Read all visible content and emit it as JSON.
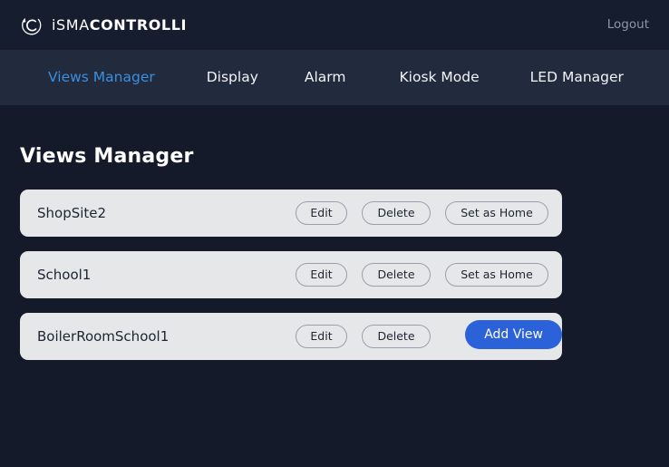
{
  "header": {
    "brand_light": "iSMA",
    "brand_bold": "CONTROLLI",
    "logo_icon": "isma-circle-logo-icon",
    "logout_label": "Logout"
  },
  "nav": {
    "items": [
      {
        "label": "Views Manager",
        "active": true
      },
      {
        "label": "Display",
        "active": false
      },
      {
        "label": "Alarm",
        "active": false
      },
      {
        "label": "Kiosk Mode",
        "active": false
      },
      {
        "label": "LED Manager",
        "active": false
      }
    ]
  },
  "main": {
    "title": "Views Manager",
    "views": [
      {
        "name": "ShopSite2",
        "edit_label": "Edit",
        "delete_label": "Delete",
        "set_home_label": "Set as Home",
        "has_set_home": true
      },
      {
        "name": "School1",
        "edit_label": "Edit",
        "delete_label": "Delete",
        "set_home_label": "Set as Home",
        "has_set_home": true
      },
      {
        "name": "BoilerRoomSchool1",
        "edit_label": "Edit",
        "delete_label": "Delete",
        "set_home_label": "",
        "has_set_home": false
      }
    ],
    "add_view_label": "Add View"
  },
  "colors": {
    "page_bg": "#141a2a",
    "header_bg": "#161d2e",
    "nav_bg": "#222a3d",
    "nav_active": "#3b8ede",
    "card_bg": "#e6e7e9",
    "card_text": "#1d2433",
    "accent_button": "#2b62d9",
    "logout_text": "#8d95a6"
  }
}
